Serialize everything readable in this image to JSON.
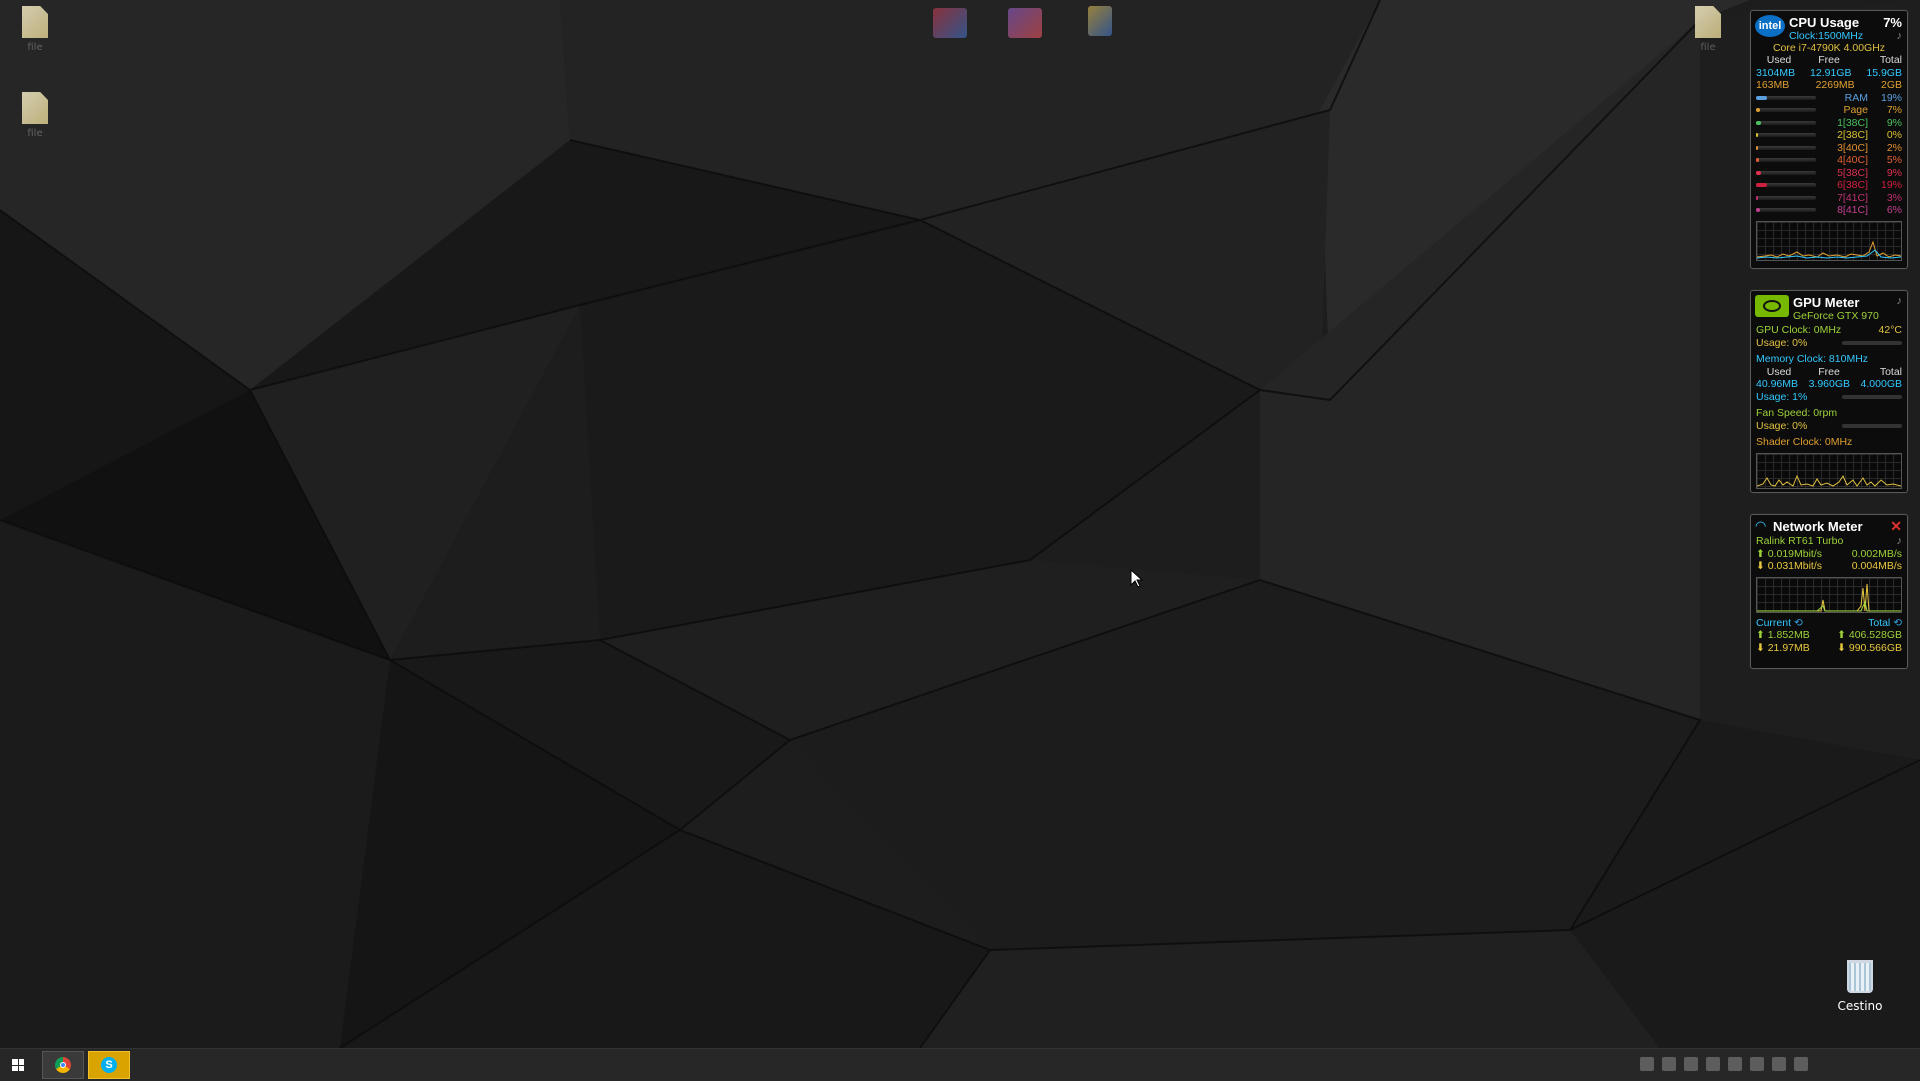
{
  "desktop": {
    "left_icons": [
      {
        "icon": "file-icon",
        "label": "file"
      },
      {
        "icon": "file-icon",
        "label": "file"
      }
    ],
    "top_shortcuts": [
      {
        "icon": "shortcut-icon",
        "color": "#c0394b"
      },
      {
        "icon": "shortcut-icon",
        "color": "#8a5cc0"
      },
      {
        "icon": "shortcut-icon",
        "color": "#d8b24a"
      }
    ],
    "right_icon": {
      "icon": "file-icon",
      "label": "file"
    },
    "recycle_bin": {
      "label": "Cestino",
      "icon": "recycle-bin-icon"
    }
  },
  "cpu_gadget": {
    "brand": "intel",
    "title": "CPU Usage",
    "total_usage": "7%",
    "clock": "Clock:1500MHz",
    "model": "Core i7-4790K 4.00GHz",
    "headers": [
      "Used",
      "Free",
      "Total"
    ],
    "memory_rows": [
      [
        "3104MB",
        "12.91GB",
        "15.9GB"
      ],
      [
        "163MB",
        "2269MB",
        "2GB"
      ]
    ],
    "bars": [
      {
        "label": "RAM",
        "value": "19%",
        "fraction": 0.19,
        "color": "#5aa0e0"
      },
      {
        "label": "Page",
        "value": "7%",
        "fraction": 0.07,
        "color": "#e0a030"
      },
      {
        "label": "1[38C]",
        "value": "9%",
        "fraction": 0.09,
        "color": "#4cc060"
      },
      {
        "label": "2[38C]",
        "value": "0%",
        "fraction": 0.0,
        "color": "#d8c030"
      },
      {
        "label": "3[40C]",
        "value": "2%",
        "fraction": 0.02,
        "color": "#e09030"
      },
      {
        "label": "4[40C]",
        "value": "5%",
        "fraction": 0.05,
        "color": "#e06030"
      },
      {
        "label": "5[38C]",
        "value": "9%",
        "fraction": 0.09,
        "color": "#e03050"
      },
      {
        "label": "6[38C]",
        "value": "19%",
        "fraction": 0.19,
        "color": "#d02040"
      },
      {
        "label": "7[41C]",
        "value": "3%",
        "fraction": 0.03,
        "color": "#c03070"
      },
      {
        "label": "8[41C]",
        "value": "6%",
        "fraction": 0.06,
        "color": "#c04090"
      }
    ]
  },
  "gpu_gadget": {
    "title": "GPU Meter",
    "model": "GeForce GTX 970",
    "gpu_clock": "GPU Clock: 0MHz",
    "temp": "42°C",
    "gpu_usage": "Usage: 0%",
    "memory_clock": "Memory Clock: 810MHz",
    "headers": [
      "Used",
      "Free",
      "Total"
    ],
    "memory_row": [
      "40.96MB",
      "3.960GB",
      "4.000GB"
    ],
    "memory_usage": "Usage: 1%",
    "fan_speed": "Fan Speed: 0rpm",
    "fan_usage": "Usage: 0%",
    "shader_clock": "Shader Clock: 0MHz"
  },
  "network_gadget": {
    "title": "Network Meter",
    "adapter": "Ralink RT61 Turbo",
    "upload_rate": "0.019Mbit/s",
    "upload_bytes": "0.002MB/s",
    "download_rate": "0.031Mbit/s",
    "download_bytes": "0.004MB/s",
    "current_label": "Current",
    "total_label": "Total",
    "current_up": "1.852MB",
    "current_down": "21.97MB",
    "total_up": "406.528GB",
    "total_down": "990.566GB"
  },
  "taskbar": {
    "start": "start-button",
    "pinned": [
      {
        "name": "chrome",
        "icon": "chrome-icon"
      },
      {
        "name": "skype",
        "icon": "skype-icon",
        "glyph": "S"
      }
    ]
  },
  "colors": {
    "cpu_cyan": "#33c8ff",
    "gpu_green": "#9ed23a",
    "gpu_yellow": "#e0c040",
    "net_green": "#9ed23a",
    "net_yellow": "#e8c840"
  }
}
